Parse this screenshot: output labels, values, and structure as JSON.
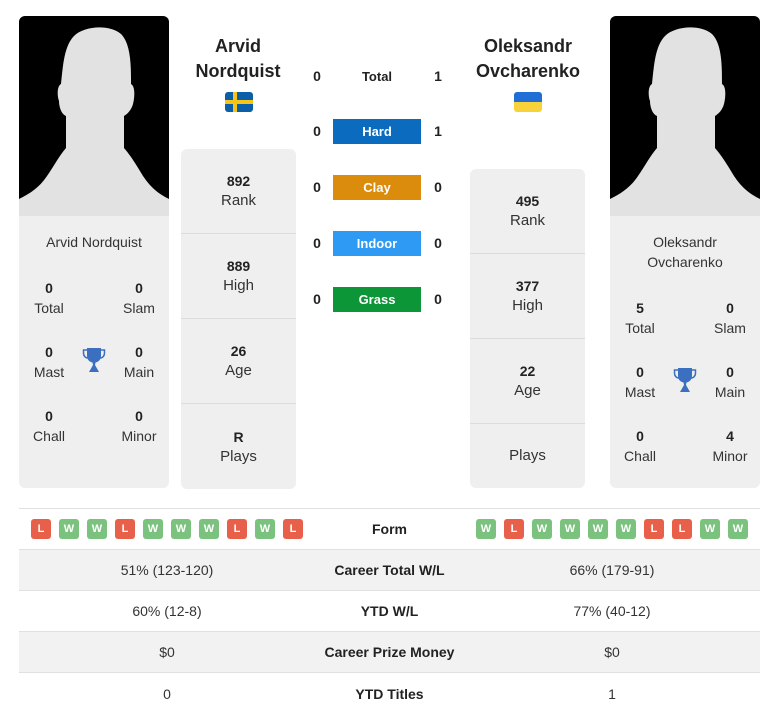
{
  "colors": {
    "hard": "#0b6cbf",
    "clay": "#dc8c0c",
    "indoor": "#2f9af3",
    "grass": "#0d9638",
    "win": "#7cc27f",
    "loss": "#e8604a",
    "trophy": "#3b6fc0"
  },
  "player1": {
    "name_line1": "Arvid",
    "name_line2": "Nordquist",
    "card_name": "Arvid Nordquist",
    "flag": "sweden",
    "titles": {
      "total": {
        "value": "0",
        "label": "Total"
      },
      "slam": {
        "value": "0",
        "label": "Slam"
      },
      "mast": {
        "value": "0",
        "label": "Mast"
      },
      "main": {
        "value": "0",
        "label": "Main"
      },
      "chall": {
        "value": "0",
        "label": "Chall"
      },
      "minor": {
        "value": "0",
        "label": "Minor"
      }
    },
    "stats": {
      "rank": {
        "value": "892",
        "label": "Rank"
      },
      "high": {
        "value": "889",
        "label": "High"
      },
      "age": {
        "value": "26",
        "label": "Age"
      },
      "plays": {
        "value": "R",
        "label": "Plays"
      }
    },
    "form": [
      "L",
      "W",
      "W",
      "L",
      "W",
      "W",
      "W",
      "L",
      "W",
      "L"
    ],
    "career_wl": "51% (123-120)",
    "ytd_wl": "60% (12-8)",
    "prize_money": "$0",
    "ytd_titles": "0"
  },
  "player2": {
    "name_line1": "Oleksandr",
    "name_line2": "Ovcharenko",
    "card_name_line1": "Oleksandr",
    "card_name_line2": "Ovcharenko",
    "flag": "ukraine",
    "titles": {
      "total": {
        "value": "5",
        "label": "Total"
      },
      "slam": {
        "value": "0",
        "label": "Slam"
      },
      "mast": {
        "value": "0",
        "label": "Mast"
      },
      "main": {
        "value": "0",
        "label": "Main"
      },
      "chall": {
        "value": "0",
        "label": "Chall"
      },
      "minor": {
        "value": "4",
        "label": "Minor"
      }
    },
    "stats": {
      "rank": {
        "value": "495",
        "label": "Rank"
      },
      "high": {
        "value": "377",
        "label": "High"
      },
      "age": {
        "value": "22",
        "label": "Age"
      },
      "plays": {
        "value": "",
        "label": "Plays"
      }
    },
    "form": [
      "W",
      "L",
      "W",
      "W",
      "W",
      "W",
      "L",
      "L",
      "W",
      "W"
    ],
    "career_wl": "66% (179-91)",
    "ytd_wl": "77% (40-12)",
    "prize_money": "$0",
    "ytd_titles": "1"
  },
  "h2h": [
    {
      "label": "Total",
      "p1": "0",
      "p2": "1"
    },
    {
      "label": "Hard",
      "p1": "0",
      "p2": "1"
    },
    {
      "label": "Clay",
      "p1": "0",
      "p2": "0"
    },
    {
      "label": "Indoor",
      "p1": "0",
      "p2": "0"
    },
    {
      "label": "Grass",
      "p1": "0",
      "p2": "0"
    }
  ],
  "table_labels": {
    "form": "Form",
    "career_wl": "Career Total W/L",
    "ytd_wl": "YTD W/L",
    "prize_money": "Career Prize Money",
    "ytd_titles": "YTD Titles"
  }
}
